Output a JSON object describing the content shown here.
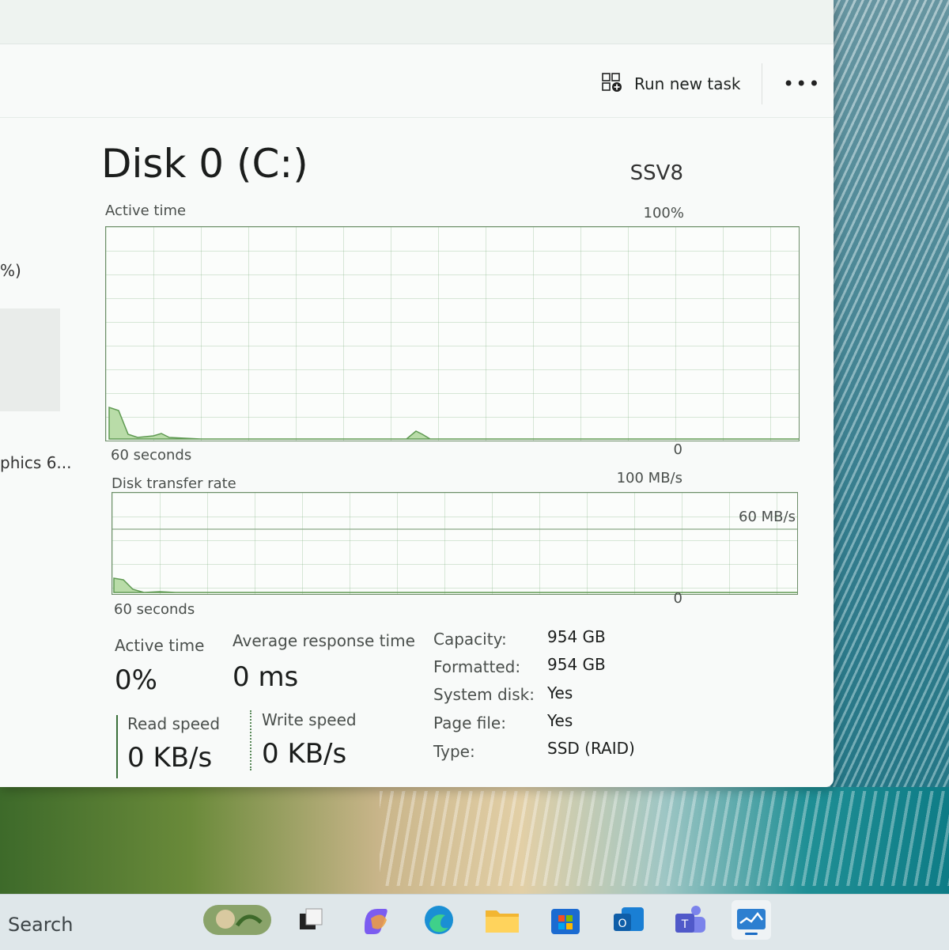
{
  "window": {
    "title": "Disk 0 (C:)",
    "model": "SSV8",
    "run_new_task": "Run new task",
    "more": "•••"
  },
  "nav": {
    "item_text_1": "%)",
    "item_text_2": "phics 6..."
  },
  "active_time_graph": {
    "label": "Active time",
    "max_label": "100%",
    "time_label": "60 seconds",
    "min_label": "0"
  },
  "transfer_graph": {
    "label": "Disk transfer rate",
    "max_label": "100 MB/s",
    "mid_label": "60 MB/s",
    "time_label": "60 seconds",
    "min_label": "0"
  },
  "stats": {
    "active_time_label": "Active time",
    "active_time_value": "0%",
    "avg_response_label": "Average response time",
    "avg_response_value": "0 ms",
    "read_speed_label": "Read speed",
    "read_speed_value": "0 KB/s",
    "write_speed_label": "Write speed",
    "write_speed_value": "0 KB/s"
  },
  "properties": [
    {
      "key": "Capacity:",
      "value": "954 GB"
    },
    {
      "key": "Formatted:",
      "value": "954 GB"
    },
    {
      "key": "System disk:",
      "value": "Yes"
    },
    {
      "key": "Page file:",
      "value": "Yes"
    },
    {
      "key": "Type:",
      "value": "SSD (RAID)"
    }
  ],
  "taskbar": {
    "search_label": "Search"
  },
  "colors": {
    "graph_line": "#5f9a52",
    "graph_fill": "#b9dca8",
    "graph_border": "#6d8d68"
  }
}
